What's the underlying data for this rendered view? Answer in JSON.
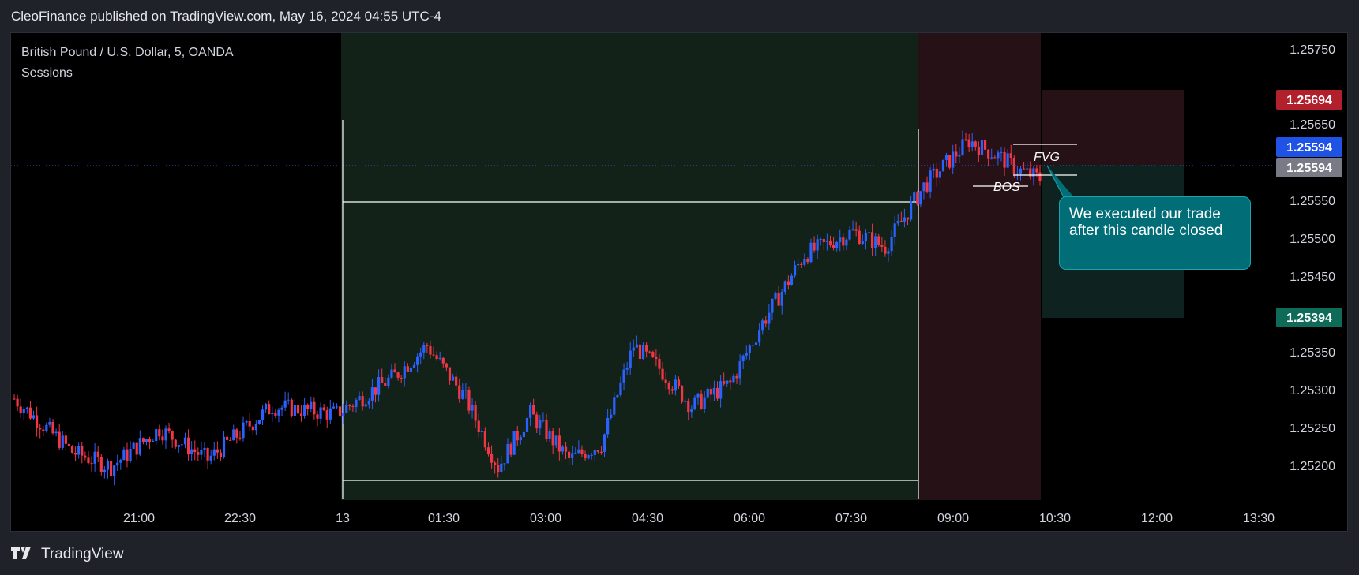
{
  "header": {
    "text": "CleoFinance published on TradingView.com, May 16, 2024 04:55 UTC-4"
  },
  "legend": {
    "symbol": "British Pound / U.S. Dollar, 5, OANDA",
    "indicator": "Sessions"
  },
  "footer": {
    "brand": "TradingView",
    "logo": "tradingview-logo-icon"
  },
  "annotations": {
    "fvg": "FVG",
    "bos": "BOS",
    "callout": "We executed our trade after this candle closed"
  },
  "colors": {
    "background": "#000000",
    "up_candle": "#2962ff",
    "down_candle": "#f23645",
    "green_session": "#1a2e22",
    "red_session": "#2a1418",
    "callout": "#006d77",
    "target_label": "#b2202c",
    "price_label": "#1e53e5",
    "current_label": "#787b86",
    "stop_label": "#0d6b58"
  },
  "chart_data": {
    "type": "candlestick",
    "symbol": "GBPUSD",
    "timeframe": "5",
    "y_axis_ticks": [
      "1.25750",
      "1.25650",
      "1.25550",
      "1.25500",
      "1.25450",
      "1.25350",
      "1.25300",
      "1.25250",
      "1.25200"
    ],
    "x_axis_ticks": [
      "21:00",
      "22:30",
      "13",
      "01:30",
      "03:00",
      "04:30",
      "06:00",
      "07:30",
      "09:00",
      "10:30",
      "12:00",
      "13:30"
    ],
    "price_labels": {
      "target": "1.25694",
      "last": "1.25594",
      "current": "1.25594",
      "stop": "1.25394"
    },
    "session_range": {
      "high": 1.2556,
      "low": 1.2518
    },
    "trade": {
      "entry": 1.25594,
      "target": 1.25694,
      "stop": 1.25394
    },
    "candles_summary": {
      "pre_session": {
        "range": [
          1.2519,
          1.2528
        ]
      },
      "asia_session": {
        "open": 1.2527,
        "low": 1.2518,
        "high": 1.2555
      },
      "london_session": {
        "open": 1.2551,
        "high": 1.2566,
        "close": 1.256
      }
    }
  }
}
